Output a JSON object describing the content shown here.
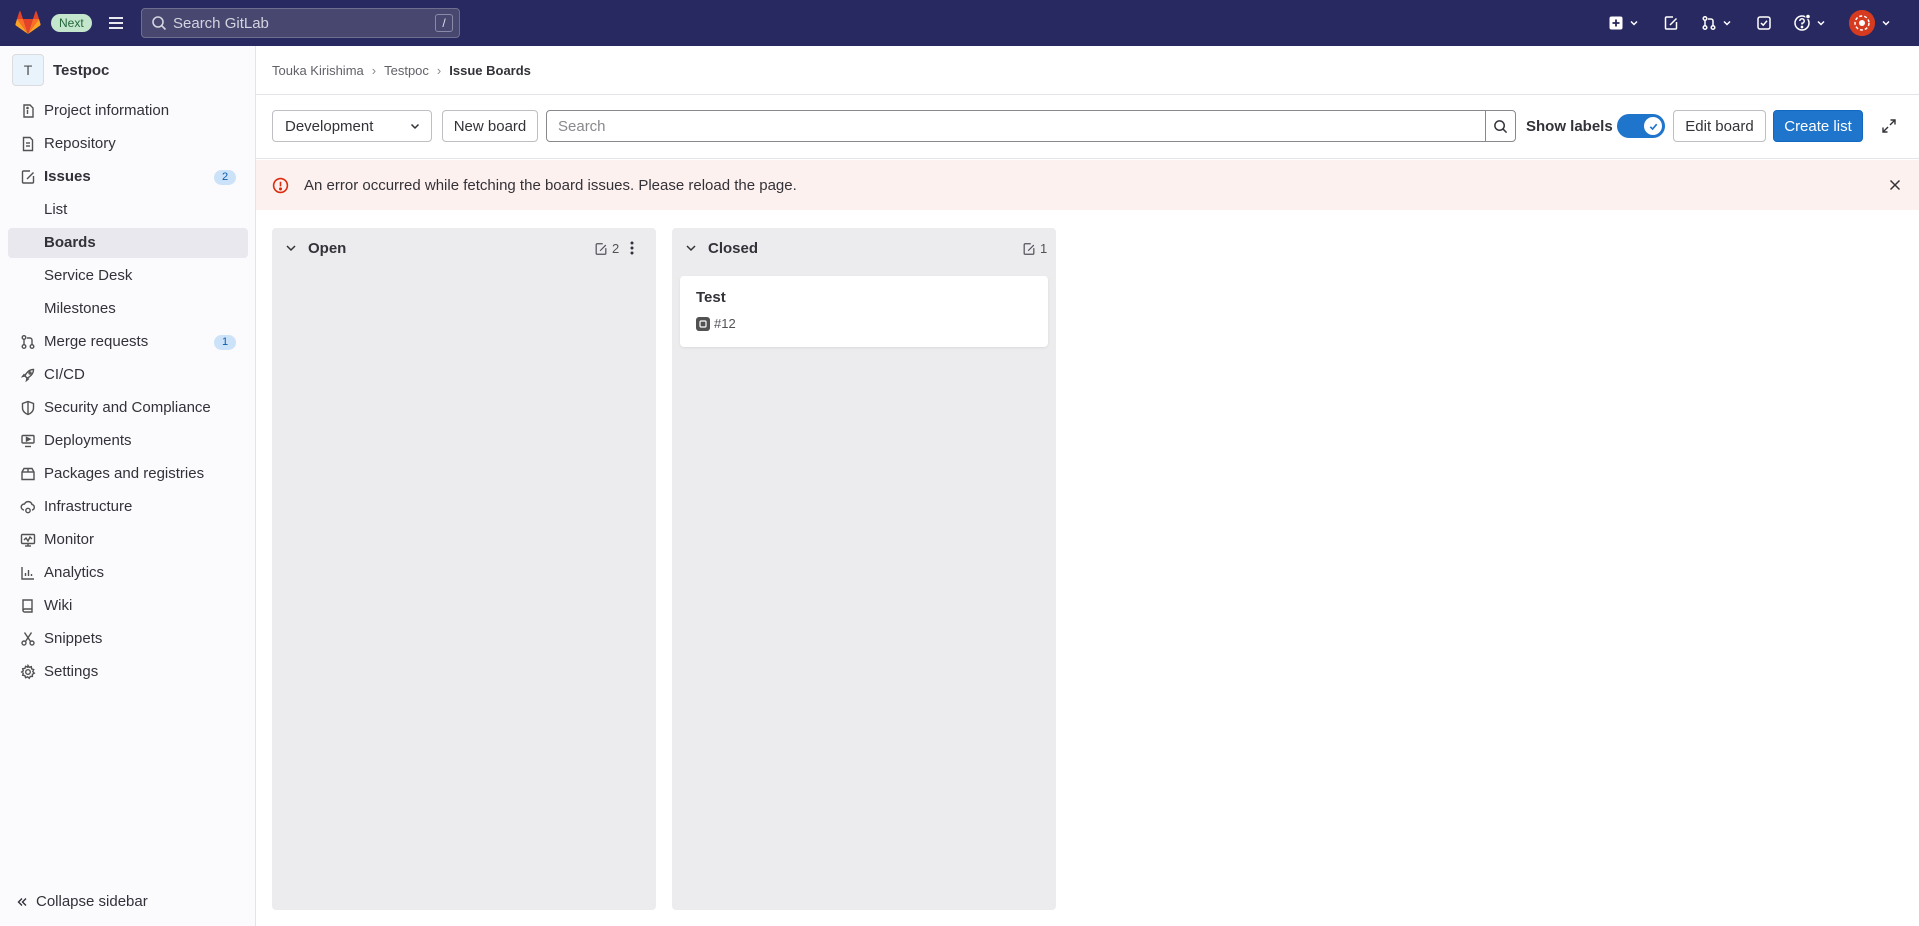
{
  "topbar": {
    "next_badge": "Next",
    "search_placeholder": "Search GitLab",
    "search_shortcut": "/"
  },
  "sidebar": {
    "project_initial": "T",
    "project_name": "Testpoc",
    "items": [
      {
        "label": "Project information",
        "icon": "info-icon"
      },
      {
        "label": "Repository",
        "icon": "document-icon"
      },
      {
        "label": "Issues",
        "icon": "issues-icon",
        "count": "2"
      },
      {
        "label": "List",
        "sub": true
      },
      {
        "label": "Boards",
        "sub": true,
        "active": true
      },
      {
        "label": "Service Desk",
        "sub": true
      },
      {
        "label": "Milestones",
        "sub": true
      },
      {
        "label": "Merge requests",
        "icon": "merge-request-icon",
        "count": "1"
      },
      {
        "label": "CI/CD",
        "icon": "rocket-icon"
      },
      {
        "label": "Security and Compliance",
        "icon": "shield-icon"
      },
      {
        "label": "Deployments",
        "icon": "deployments-icon"
      },
      {
        "label": "Packages and registries",
        "icon": "package-icon"
      },
      {
        "label": "Infrastructure",
        "icon": "cloud-gear-icon"
      },
      {
        "label": "Monitor",
        "icon": "monitor-icon"
      },
      {
        "label": "Analytics",
        "icon": "chart-icon"
      },
      {
        "label": "Wiki",
        "icon": "book-icon"
      },
      {
        "label": "Snippets",
        "icon": "snippet-icon"
      },
      {
        "label": "Settings",
        "icon": "gear-icon"
      }
    ],
    "collapse_label": "Collapse sidebar"
  },
  "breadcrumb": {
    "items": [
      "Touka Kirishima",
      "Testpoc",
      "Issue Boards"
    ]
  },
  "toolbar": {
    "board_select": "Development",
    "new_board": "New board",
    "search_placeholder": "Search",
    "show_labels": "Show labels",
    "show_labels_on": true,
    "edit_board": "Edit board",
    "create_list": "Create list"
  },
  "alert": {
    "message": "An error occurred while fetching the board issues. Please reload the page."
  },
  "boards": [
    {
      "title": "Open",
      "count": "2",
      "cards": []
    },
    {
      "title": "Closed",
      "count": "1",
      "cards": [
        {
          "title": "Test",
          "ref": "#12"
        }
      ]
    }
  ],
  "colors": {
    "navbar": "#292961",
    "primary": "#1f75cb",
    "alert_bg": "#fcf1ef",
    "danger": "#dd2b0e",
    "board_bg": "#ececef"
  }
}
